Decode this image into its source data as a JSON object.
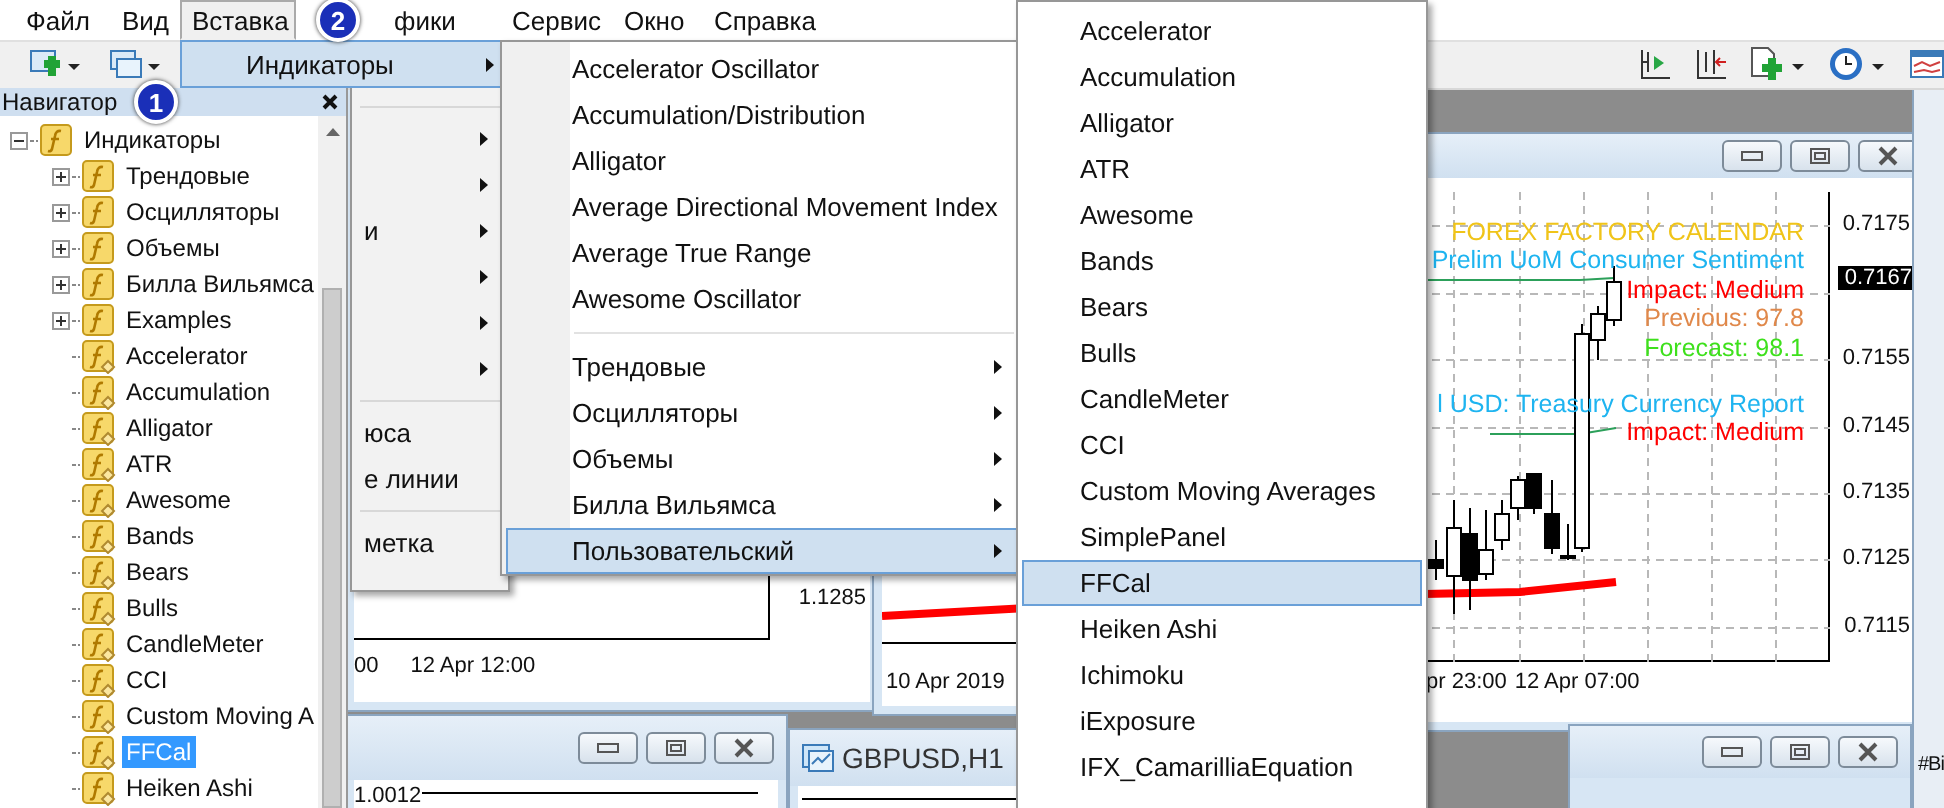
{
  "menu_bar": {
    "items": [
      {
        "label": "Файл",
        "selected": false
      },
      {
        "label": "Вид",
        "selected": false
      },
      {
        "label": "Вставка",
        "selected": true
      },
      {
        "label": "фики",
        "selected": false
      },
      {
        "label": "Сервис",
        "selected": false
      },
      {
        "label": "Окно",
        "selected": false
      },
      {
        "label": "Справка",
        "selected": false
      }
    ]
  },
  "callouts": [
    "1",
    "2"
  ],
  "navigator": {
    "title": "Навигатор",
    "tree": [
      {
        "label": "Индикаторы",
        "kind": "folder",
        "expanded": true,
        "selected": false,
        "children": [
          {
            "label": "Трендовые",
            "kind": "folder",
            "expanded": false,
            "selected": false
          },
          {
            "label": "Осцилляторы",
            "kind": "folder",
            "expanded": false,
            "selected": false
          },
          {
            "label": "Объемы",
            "kind": "folder",
            "expanded": false,
            "selected": false
          },
          {
            "label": "Билла Вильямса",
            "kind": "folder",
            "expanded": false,
            "selected": false
          },
          {
            "label": "Examples",
            "kind": "folder",
            "expanded": false,
            "selected": false
          },
          {
            "label": "Accelerator",
            "kind": "indicator",
            "selected": false
          },
          {
            "label": "Accumulation",
            "kind": "indicator",
            "selected": false
          },
          {
            "label": "Alligator",
            "kind": "indicator",
            "selected": false
          },
          {
            "label": "ATR",
            "kind": "indicator",
            "selected": false
          },
          {
            "label": "Awesome",
            "kind": "indicator",
            "selected": false
          },
          {
            "label": "Bands",
            "kind": "indicator",
            "selected": false
          },
          {
            "label": "Bears",
            "kind": "indicator",
            "selected": false
          },
          {
            "label": "Bulls",
            "kind": "indicator",
            "selected": false
          },
          {
            "label": "CandleMeter",
            "kind": "indicator",
            "selected": false
          },
          {
            "label": "CCI",
            "kind": "indicator",
            "selected": false
          },
          {
            "label": "Custom Moving A",
            "kind": "indicator",
            "selected": false
          },
          {
            "label": "FFCal",
            "kind": "indicator",
            "selected": true
          },
          {
            "label": "Heiken Ashi",
            "kind": "indicator",
            "selected": false
          }
        ]
      }
    ]
  },
  "insert_menu": {
    "items": [
      {
        "kind": "item",
        "label": "Индикаторы",
        "submenu": true,
        "selected": true
      },
      {
        "kind": "separator"
      },
      {
        "kind": "item",
        "submenu": true,
        "selected": false
      },
      {
        "kind": "item",
        "submenu": true,
        "selected": false
      },
      {
        "kind": "item",
        "label": "и",
        "submenu": true,
        "selected": false
      },
      {
        "kind": "item",
        "submenu": true,
        "selected": false
      },
      {
        "kind": "item",
        "submenu": true,
        "selected": false
      },
      {
        "kind": "item",
        "submenu": true,
        "selected": false
      },
      {
        "kind": "separator"
      },
      {
        "kind": "item",
        "label": "юса",
        "submenu": false,
        "selected": false
      },
      {
        "kind": "item",
        "label": "е линии",
        "submenu": false,
        "selected": false
      },
      {
        "kind": "separator"
      },
      {
        "kind": "item",
        "label": "метка",
        "submenu": false,
        "selected": false
      }
    ]
  },
  "indicators_menu": {
    "items": [
      {
        "kind": "item",
        "label": "Accelerator Oscillator",
        "submenu": false,
        "selected": false
      },
      {
        "kind": "item",
        "label": "Accumulation/Distribution",
        "submenu": false,
        "selected": false
      },
      {
        "kind": "item",
        "label": "Alligator",
        "submenu": false,
        "selected": false
      },
      {
        "kind": "item",
        "label": "Average Directional Movement Index",
        "submenu": false,
        "selected": false
      },
      {
        "kind": "item",
        "label": "Average True Range",
        "submenu": false,
        "selected": false
      },
      {
        "kind": "item",
        "label": "Awesome Oscillator",
        "submenu": false,
        "selected": false
      },
      {
        "kind": "separator"
      },
      {
        "kind": "item",
        "label": "Трендовые",
        "submenu": true,
        "selected": false
      },
      {
        "kind": "item",
        "label": "Осцилляторы",
        "submenu": true,
        "selected": false
      },
      {
        "kind": "item",
        "label": "Объемы",
        "submenu": true,
        "selected": false
      },
      {
        "kind": "item",
        "label": "Билла Вильямса",
        "submenu": true,
        "selected": false
      },
      {
        "kind": "item",
        "label": "Пользовательский",
        "submenu": true,
        "selected": true
      }
    ]
  },
  "custom_menu": {
    "items": [
      {
        "label": "Accelerator",
        "selected": false
      },
      {
        "label": "Accumulation",
        "selected": false
      },
      {
        "label": "Alligator",
        "selected": false
      },
      {
        "label": "ATR",
        "selected": false
      },
      {
        "label": "Awesome",
        "selected": false
      },
      {
        "label": "Bands",
        "selected": false
      },
      {
        "label": "Bears",
        "selected": false
      },
      {
        "label": "Bulls",
        "selected": false
      },
      {
        "label": "CandleMeter",
        "selected": false
      },
      {
        "label": "CCI",
        "selected": false
      },
      {
        "label": "Custom Moving Averages",
        "selected": false
      },
      {
        "label": "SimplePanel",
        "selected": false
      },
      {
        "label": "FFCal",
        "selected": true
      },
      {
        "label": "Heiken Ashi",
        "selected": false
      },
      {
        "label": "Ichimoku",
        "selected": false
      },
      {
        "label": "iExposure",
        "selected": false
      },
      {
        "label": "IFX_CamarilliaEquation",
        "selected": false
      }
    ]
  },
  "chart_windows": [
    {
      "price_labels": [
        "1.1285"
      ],
      "time_labels": [
        "00",
        "12 Apr 12:00"
      ]
    },
    {
      "time_labels": [
        "10 Apr 2019"
      ]
    },
    {
      "price_labels": [
        "0.7175",
        "0.7155",
        "0.7145",
        "0.7135",
        "0.7125",
        "0.7115"
      ],
      "current_price": "0.7167",
      "time_labels": [
        "pr 23:00",
        "12 Apr 07:00"
      ],
      "calendar": {
        "title": {
          "text": "FOREX FACTORY CALENDAR",
          "color": "#f0c419"
        },
        "events": [
          {
            "lines": [
              {
                "text": "Prelim UoM Consumer Sentiment",
                "color": "#1eb4f0"
              },
              {
                "text": "Impact: Medium",
                "color": "#ff0000"
              },
              {
                "text": "Previous: 97.8",
                "color": "#e0884a"
              },
              {
                "text": "Forecast: 98.1",
                "color": "#3ee01c"
              }
            ]
          },
          {
            "lines": [
              {
                "text": "l USD: Treasury Currency Report",
                "color": "#1eb4f0"
              },
              {
                "text": "Impact: Medium",
                "color": "#ff0000"
              }
            ]
          }
        ]
      }
    },
    {
      "price_labels": [
        "1.0012"
      ]
    },
    {
      "title": "GBPUSD,H1"
    },
    {
      "title": "#Bi"
    }
  ]
}
